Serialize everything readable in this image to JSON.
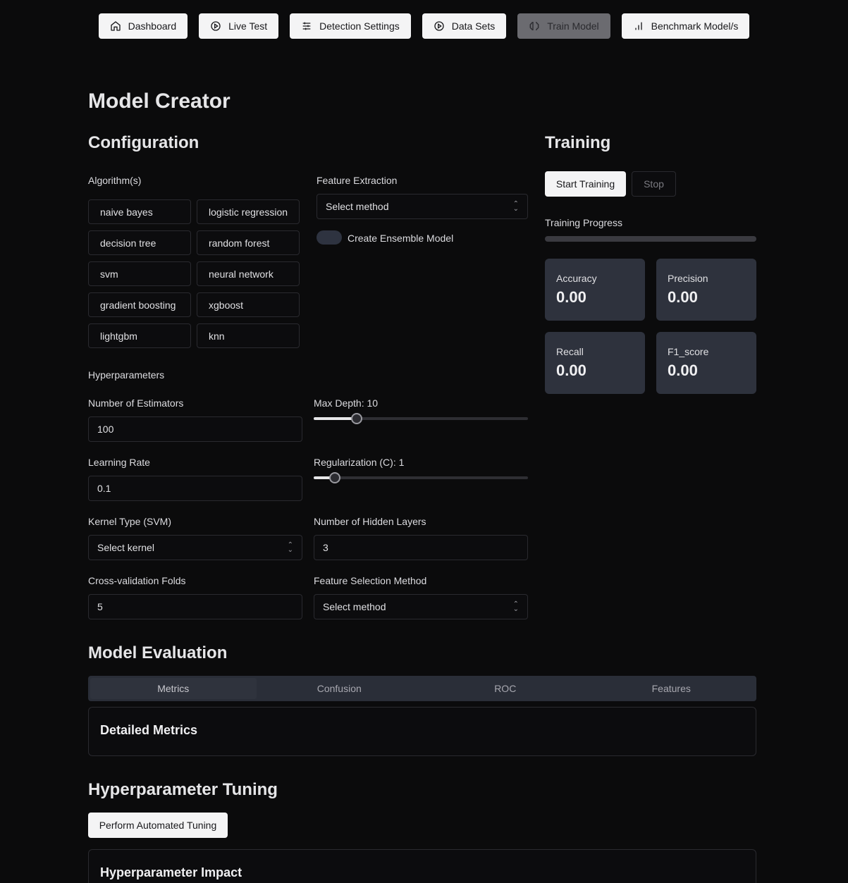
{
  "nav": [
    {
      "label": "Dashboard",
      "icon": "home-icon",
      "active": false
    },
    {
      "label": "Live Test",
      "icon": "play-circle-icon",
      "active": false
    },
    {
      "label": "Detection Settings",
      "icon": "sliders-icon",
      "active": false
    },
    {
      "label": "Data Sets",
      "icon": "play-circle-icon",
      "active": false
    },
    {
      "label": "Train Model",
      "icon": "brain-icon",
      "active": true
    },
    {
      "label": "Benchmark Model/s",
      "icon": "bar-chart-icon",
      "active": false
    }
  ],
  "page_title": "Model Creator",
  "config": {
    "heading": "Configuration",
    "algorithms_label": "Algorithm(s)",
    "algorithms": [
      "naive bayes",
      "logistic regression",
      "decision tree",
      "random forest",
      "svm",
      "neural network",
      "gradient boosting",
      "xgboost",
      "lightgbm",
      "knn"
    ],
    "feature_extraction_label": "Feature Extraction",
    "feature_extraction_value": "Select method",
    "ensemble_label": "Create Ensemble Model",
    "hyperparameters_label": "Hyperparameters",
    "estimators_label": "Number of Estimators",
    "estimators_value": "100",
    "max_depth_label": "Max Depth: 10",
    "max_depth_fraction": 0.2,
    "learning_rate_label": "Learning Rate",
    "learning_rate_value": "0.1",
    "regularization_label": "Regularization (C): 1",
    "regularization_fraction": 0.1,
    "kernel_label": "Kernel Type (SVM)",
    "kernel_value": "Select kernel",
    "hidden_layers_label": "Number of Hidden Layers",
    "hidden_layers_value": "3",
    "cv_folds_label": "Cross-validation Folds",
    "cv_folds_value": "5",
    "feature_selection_label": "Feature Selection Method",
    "feature_selection_value": "Select method"
  },
  "training": {
    "heading": "Training",
    "start_label": "Start Training",
    "stop_label": "Stop",
    "progress_label": "Training Progress",
    "progress_fraction": 0,
    "metrics": [
      {
        "label": "Accuracy",
        "value": "0.00"
      },
      {
        "label": "Precision",
        "value": "0.00"
      },
      {
        "label": "Recall",
        "value": "0.00"
      },
      {
        "label": "F1_score",
        "value": "0.00"
      }
    ]
  },
  "evaluation": {
    "heading": "Model Evaluation",
    "tabs": [
      "Metrics",
      "Confusion",
      "ROC",
      "Features"
    ],
    "active_tab": "Metrics",
    "card_title": "Detailed Metrics"
  },
  "tuning": {
    "heading": "Hyperparameter Tuning",
    "button_label": "Perform Automated Tuning",
    "card_title": "Hyperparameter Impact"
  }
}
